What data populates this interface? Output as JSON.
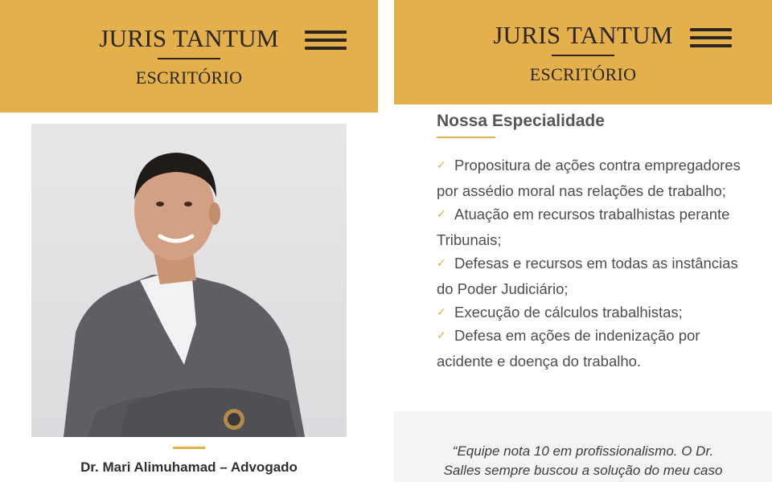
{
  "brand": {
    "title": "JURIS TANTUM",
    "subtitle": "ESCRITÓRIO"
  },
  "colors": {
    "accent": "#e3b04b",
    "text_dark": "#2b2620",
    "testimonial_bg": "#f4f4f4"
  },
  "icons": {
    "menu": "hamburger-icon",
    "bullet": "check-icon"
  },
  "profile": {
    "caption": "Dr. Mari Alimuhamad – Advogado"
  },
  "specialty": {
    "title": "Nossa Especialidade",
    "items": [
      "Propositura de ações contra empregadores por assédio moral nas relações de trabalho;",
      "Atuação em recursos trabalhistas perante Tribunais;",
      "Defesas e recursos em todas as instâncias do Poder Judiciário;",
      "Execução de cálculos trabalhistas;",
      "Defesa em ações de indenização por acidente e doença do trabalho."
    ]
  },
  "testimonial": {
    "text": "“Equipe nota 10 em profissionalismo. O Dr. Salles sempre buscou a solução do meu caso"
  }
}
